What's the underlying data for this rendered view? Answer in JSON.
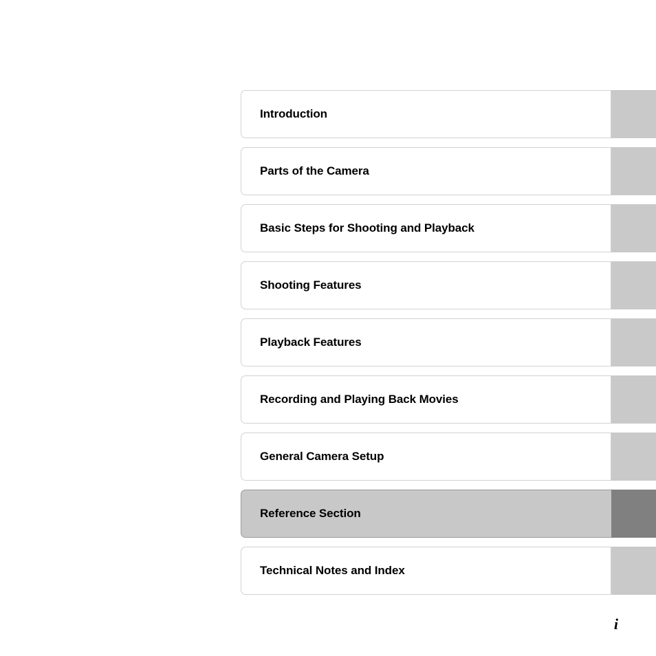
{
  "page": {
    "folio": "i",
    "background_color": "#ffffff"
  },
  "colors": {
    "tab_block": "#c9c9c9",
    "tab_block_active": "#808080",
    "card_active_fill": "#c8c8c8",
    "card_border": "#d2d2d2",
    "card_border_active": "#9a9a9a",
    "text": "#000000"
  },
  "chapter_index": {
    "items": [
      {
        "label": "Introduction",
        "active": false
      },
      {
        "label": "Parts of the Camera",
        "active": false
      },
      {
        "label": "Basic Steps for Shooting and Playback",
        "active": false
      },
      {
        "label": "Shooting Features",
        "active": false
      },
      {
        "label": "Playback Features",
        "active": false
      },
      {
        "label": "Recording and Playing Back Movies",
        "active": false
      },
      {
        "label": "General Camera Setup",
        "active": false
      },
      {
        "label": "Reference Section",
        "active": true
      },
      {
        "label": "Technical Notes and Index",
        "active": false
      }
    ]
  }
}
